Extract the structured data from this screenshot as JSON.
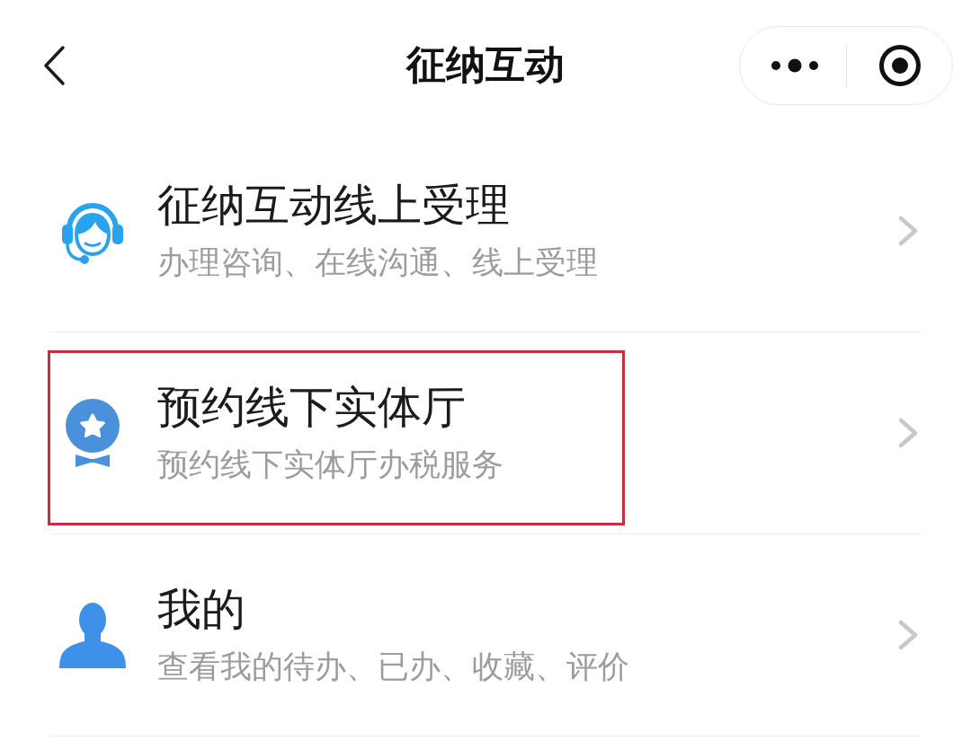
{
  "navbar": {
    "title": "征纳互动"
  },
  "menu": [
    {
      "kind": "headset",
      "title": "征纳互动线上受理",
      "subtitle": "办理咨询、在线沟通、线上受理",
      "highlighted": false
    },
    {
      "kind": "badge",
      "title": "预约线下实体厅",
      "subtitle": "预约线下实体厅办税服务",
      "highlighted": true
    },
    {
      "kind": "person",
      "title": "我的",
      "subtitle": "查看我的待办、已办、收藏、评价",
      "highlighted": false
    }
  ]
}
